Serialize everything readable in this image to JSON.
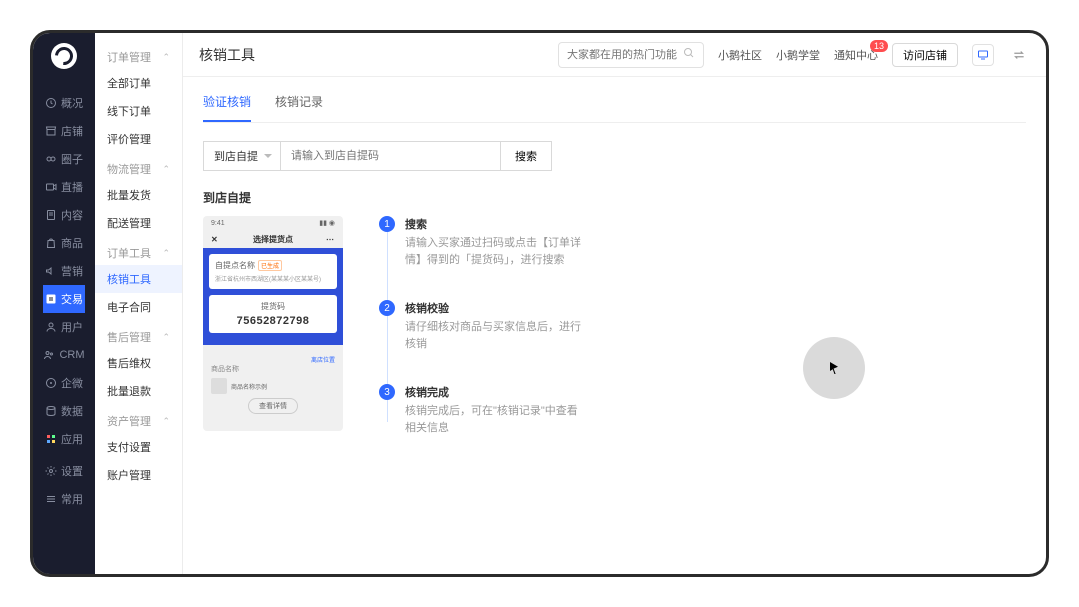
{
  "dark_sidebar": [
    {
      "icon": "clock",
      "label": "概况"
    },
    {
      "icon": "shop",
      "label": "店铺"
    },
    {
      "icon": "circle",
      "label": "圈子"
    },
    {
      "icon": "video",
      "label": "直播"
    },
    {
      "icon": "doc",
      "label": "内容"
    },
    {
      "icon": "bag",
      "label": "商品"
    },
    {
      "icon": "speaker",
      "label": "营销"
    },
    {
      "icon": "exchange",
      "label": "交易",
      "active": true
    },
    {
      "icon": "user",
      "label": "用户"
    },
    {
      "icon": "crm",
      "label": "CRM"
    },
    {
      "icon": "ent",
      "label": "企微"
    },
    {
      "icon": "data",
      "label": "数据"
    },
    {
      "icon": "app",
      "label": "应用"
    },
    {
      "icon": "gear",
      "label": "设置",
      "gap": true
    },
    {
      "icon": "list",
      "label": "常用"
    }
  ],
  "sub_sidebar": [
    {
      "type": "header",
      "label": "订单管理"
    },
    {
      "type": "item",
      "label": "全部订单"
    },
    {
      "type": "item",
      "label": "线下订单"
    },
    {
      "type": "item",
      "label": "评价管理"
    },
    {
      "type": "header",
      "label": "物流管理"
    },
    {
      "type": "item",
      "label": "批量发货"
    },
    {
      "type": "item",
      "label": "配送管理"
    },
    {
      "type": "header",
      "label": "订单工具"
    },
    {
      "type": "item",
      "label": "核销工具",
      "active": true
    },
    {
      "type": "item",
      "label": "电子合同"
    },
    {
      "type": "header",
      "label": "售后管理"
    },
    {
      "type": "item",
      "label": "售后维权"
    },
    {
      "type": "item",
      "label": "批量退款"
    },
    {
      "type": "header",
      "label": "资产管理"
    },
    {
      "type": "item",
      "label": "支付设置"
    },
    {
      "type": "item",
      "label": "账户管理"
    }
  ],
  "topbar": {
    "title": "核销工具",
    "search_placeholder": "大家都在用的热门功能",
    "links": [
      "小鹅社区",
      "小鹅学堂",
      "通知中心"
    ],
    "badge": "13",
    "visit_shop": "访问店铺"
  },
  "tabs": [
    {
      "label": "验证核销",
      "active": true
    },
    {
      "label": "核销记录"
    }
  ],
  "verify": {
    "select": "到店自提",
    "input_placeholder": "请输入到店自提码",
    "search_btn": "搜索",
    "section_title": "到店自提"
  },
  "phone": {
    "time": "9:41",
    "header": "选择提货点",
    "point_label": "自提点名称",
    "tag": "已生成",
    "addr": "浙江省杭州市西湖区(某某某小区某某号)",
    "code_label": "提货码",
    "code": "75652872798",
    "nav_link": "离店位置",
    "prod_label": "商品名称",
    "prod_name": "商品名称示例",
    "view_btn": "查看详情"
  },
  "steps": [
    {
      "n": "1",
      "title": "搜索",
      "desc": "请输入买家通过扫码或点击【订单详情】得到的「提货码」，进行搜索"
    },
    {
      "n": "2",
      "title": "核销校验",
      "desc": "请仔细核对商品与买家信息后，进行核销"
    },
    {
      "n": "3",
      "title": "核销完成",
      "desc": "核销完成后，可在\"核销记录\"中查看相关信息"
    }
  ]
}
